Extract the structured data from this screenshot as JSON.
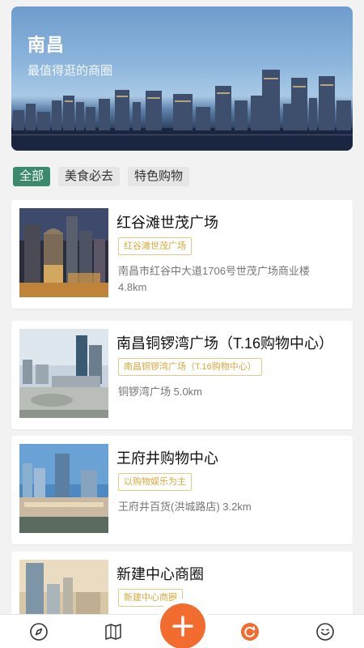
{
  "hero": {
    "title": "南昌",
    "subtitle": "最值得逛的商圈"
  },
  "filters": [
    {
      "label": "全部",
      "active": true
    },
    {
      "label": "美食必去",
      "active": false
    },
    {
      "label": "特色购物",
      "active": false
    }
  ],
  "malls": [
    {
      "name": "红谷滩世茂广场",
      "tag": "红谷滩世茂广场",
      "address": "南昌市红谷中大道1706号世茂广场商业楼",
      "distance": "4.8km"
    },
    {
      "name": "南昌铜锣湾广场（T.16购物中心）",
      "tag": "南昌铜锣湾广场（T.16购物中心）",
      "address": "铜锣湾广场 5.0km"
    },
    {
      "name": "王府井购物中心",
      "tag": "以购物娱乐为主",
      "address": "王府井百货(洪城路店) 3.2km"
    },
    {
      "name": "新建中心商圈",
      "tag": "新建中心商圈"
    }
  ],
  "tabbar": {
    "icons": [
      "compass-icon",
      "map-icon",
      "add-icon",
      "refresh-icon",
      "smile-icon"
    ],
    "accent": "#f26b2f"
  },
  "colors": {
    "active_chip": "#3b8a6c",
    "tag": "#d7a93f"
  }
}
